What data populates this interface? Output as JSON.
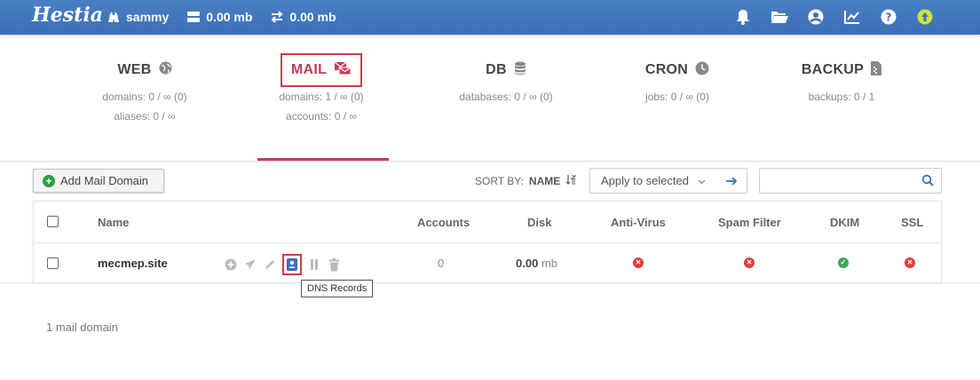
{
  "header": {
    "logo": "Hestia",
    "user": "sammy",
    "disk": "0.00 mb",
    "bandwidth": "0.00 mb",
    "icons": [
      "user-icon",
      "disk-icon",
      "bandwidth-icon",
      "notifications-icon",
      "folder-icon",
      "account-icon",
      "stats-icon",
      "help-icon",
      "update-icon"
    ]
  },
  "tabs": [
    {
      "title": "WEB",
      "icon": "globe-icon",
      "stats": [
        "domains: 0 / ∞ (0)",
        "aliases: 0 / ∞"
      ]
    },
    {
      "title": "MAIL",
      "icon": "mail-icon",
      "stats": [
        "domains: 1 / ∞ (0)",
        "accounts: 0 / ∞"
      ],
      "active": true
    },
    {
      "title": "DB",
      "icon": "database-icon",
      "stats": [
        "databases: 0 / ∞ (0)"
      ]
    },
    {
      "title": "CRON",
      "icon": "clock-icon",
      "stats": [
        "jobs: 0 / ∞ (0)"
      ]
    },
    {
      "title": "BACKUP",
      "icon": "file-icon",
      "stats": [
        "backups: 0 / 1"
      ]
    }
  ],
  "toolbar": {
    "add_label": "Add Mail Domain",
    "sort_label": "SORT BY:",
    "sort_value": "NAME",
    "apply_label": "Apply to selected"
  },
  "table": {
    "columns": [
      "Name",
      "Accounts",
      "Disk",
      "Anti-Virus",
      "Spam Filter",
      "DKIM",
      "SSL"
    ],
    "rows": [
      {
        "name": "mecmep.site",
        "accounts": "0",
        "disk_value": "0.00",
        "disk_unit": "mb",
        "antivirus": "off",
        "spam": "off",
        "dkim": "on",
        "ssl": "off"
      }
    ]
  },
  "tooltip": "DNS Records",
  "footer": "1 mail domain",
  "colors": {
    "accent": "#c83a5e",
    "topbar": "#3c6fb6",
    "on": "#3aa659",
    "off": "#e23c3c"
  }
}
